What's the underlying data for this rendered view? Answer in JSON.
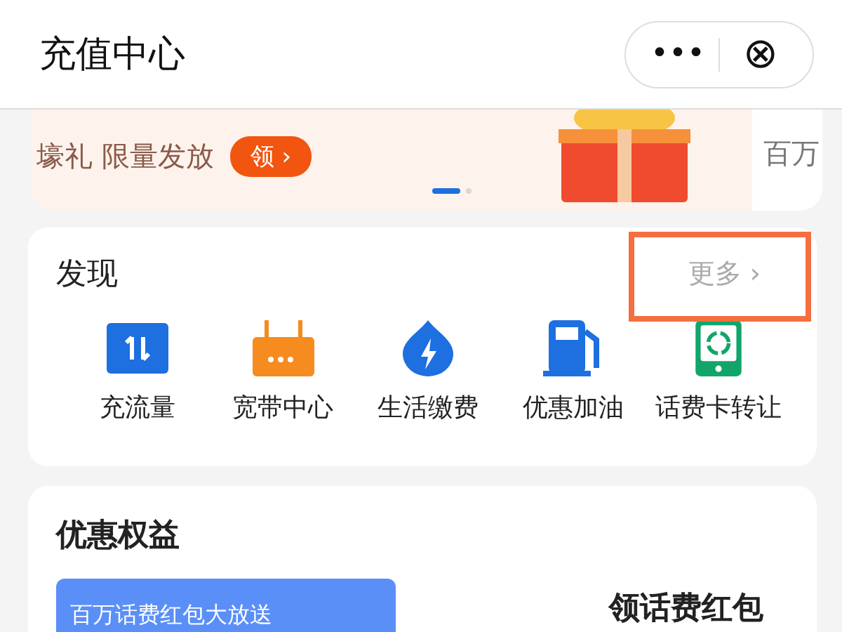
{
  "header": {
    "title": "充值中心",
    "more_label": "•••",
    "close_label": "⊗"
  },
  "banner": {
    "text": "壕礼 限量发放",
    "button": "领 ›",
    "pages": [
      {
        "selected": true
      },
      {
        "selected": false
      }
    ],
    "next_card_text": "百万"
  },
  "discover": {
    "title": "发现",
    "more": "更多 ›",
    "highlighted": true,
    "items": [
      {
        "kind": "traffic",
        "label": "充流量"
      },
      {
        "kind": "router",
        "label": "宽带中心"
      },
      {
        "kind": "bolt",
        "label": "生活缴费"
      },
      {
        "kind": "fuel",
        "label": "优惠加油"
      },
      {
        "kind": "card",
        "label": "话费卡转让"
      }
    ]
  },
  "benefits": {
    "title": "优惠权益",
    "promo_card": "百万话费红包大放送",
    "side_title": "领话费红包"
  }
}
